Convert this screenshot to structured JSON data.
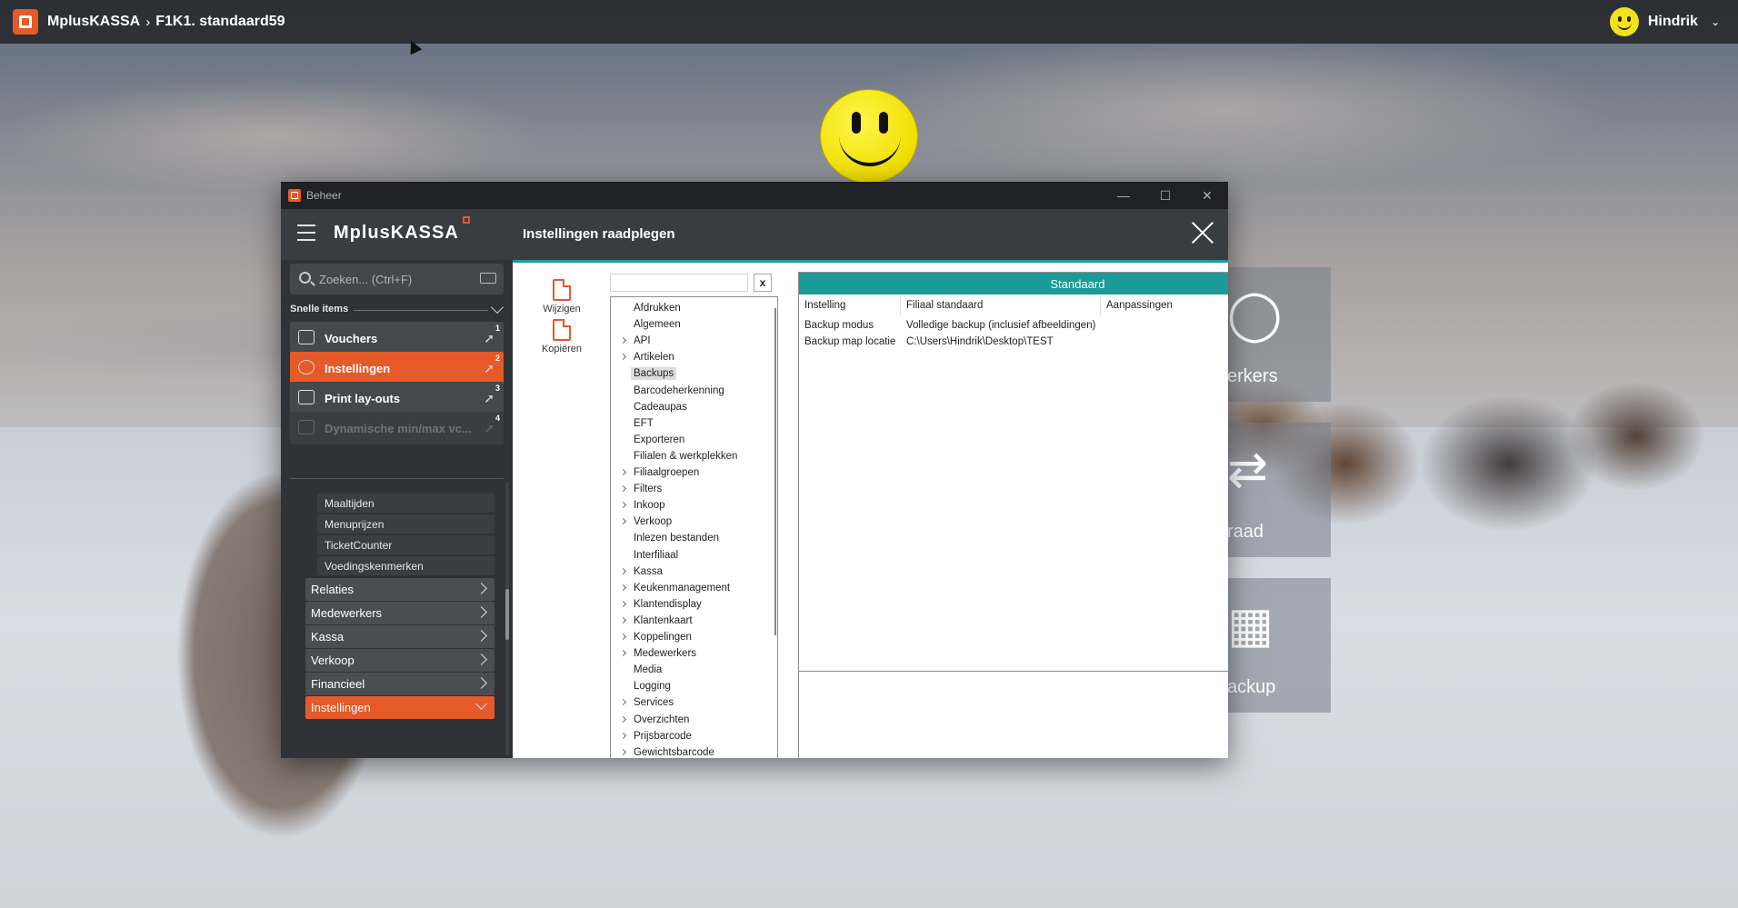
{
  "topbar": {
    "app_name": "MplusKASSA",
    "crumb_sep": "›",
    "location": "F1K1. standaard59",
    "user_name": "Hindrik"
  },
  "background_tiles": [
    {
      "label": "erkers",
      "icon": "person-icon"
    },
    {
      "label": "raad",
      "icon": "transfer-icon"
    },
    {
      "label": "ackup",
      "icon": "grid-icon"
    }
  ],
  "window": {
    "title": "Beheer",
    "minimize": "—",
    "maximize": "☐",
    "close": "✕"
  },
  "header": {
    "brand": "MplusKASSA",
    "title": "Instellingen raadplegen"
  },
  "sidebar": {
    "search_placeholder": "Zoeken... (Ctrl+F)",
    "quick_label": "Snelle items",
    "quick_items": [
      {
        "label": "Vouchers",
        "num": "1",
        "state": "normal"
      },
      {
        "label": "Instellingen",
        "num": "2",
        "state": "active"
      },
      {
        "label": "Print lay-outs",
        "num": "3",
        "state": "normal"
      },
      {
        "label": "Dynamische min/max vc...",
        "num": "4",
        "state": "disabled"
      }
    ],
    "sub_items": [
      "Maaltijden",
      "Menuprijzen",
      "TicketCounter",
      "Voedingskenmerken"
    ],
    "nav_items": [
      {
        "label": "Relaties",
        "active": false
      },
      {
        "label": "Medewerkers",
        "active": false
      },
      {
        "label": "Kassa",
        "active": false
      },
      {
        "label": "Verkoop",
        "active": false
      },
      {
        "label": "Financieel",
        "active": false
      },
      {
        "label": "Instellingen",
        "active": true
      }
    ]
  },
  "actions": {
    "edit_label": "Wijzigen",
    "copy_label": "Kopiëren"
  },
  "filter": {
    "value": "",
    "clear_label": "x"
  },
  "tree": [
    {
      "label": "Afdrukken",
      "expandable": false
    },
    {
      "label": "Algemeen",
      "expandable": false
    },
    {
      "label": "API",
      "expandable": true
    },
    {
      "label": "Artikelen",
      "expandable": true
    },
    {
      "label": "Backups",
      "expandable": false,
      "selected": true
    },
    {
      "label": "Barcodeherkenning",
      "expandable": false
    },
    {
      "label": "Cadeaupas",
      "expandable": false
    },
    {
      "label": "EFT",
      "expandable": false
    },
    {
      "label": "Exporteren",
      "expandable": false
    },
    {
      "label": "Filialen & werkplekken",
      "expandable": false
    },
    {
      "label": "Filiaalgroepen",
      "expandable": true
    },
    {
      "label": "Filters",
      "expandable": true
    },
    {
      "label": "Inkoop",
      "expandable": true
    },
    {
      "label": "Verkoop",
      "expandable": true
    },
    {
      "label": "Inlezen bestanden",
      "expandable": false
    },
    {
      "label": "Interfiliaal",
      "expandable": false
    },
    {
      "label": "Kassa",
      "expandable": true
    },
    {
      "label": "Keukenmanagement",
      "expandable": true
    },
    {
      "label": "Klantendisplay",
      "expandable": true
    },
    {
      "label": "Klantenkaart",
      "expandable": true
    },
    {
      "label": "Koppelingen",
      "expandable": true
    },
    {
      "label": "Medewerkers",
      "expandable": true
    },
    {
      "label": "Media",
      "expandable": false
    },
    {
      "label": "Logging",
      "expandable": false
    },
    {
      "label": "Services",
      "expandable": true
    },
    {
      "label": "Overzichten",
      "expandable": true
    },
    {
      "label": "Prijsbarcode",
      "expandable": true
    },
    {
      "label": "Gewichtsbarcode",
      "expandable": true
    }
  ],
  "grid": {
    "group_header": "Standaard",
    "columns": [
      "Instelling",
      "Filiaal standaard",
      "Aanpassingen"
    ],
    "rows": [
      [
        "Backup modus",
        "Volledige backup (inclusief afbeeldingen)",
        ""
      ],
      [
        "Backup map locatie",
        "C:\\Users\\Hindrik\\Desktop\\TEST",
        ""
      ]
    ]
  },
  "colors": {
    "accent": "#e55a28",
    "teal": "#1a9b98",
    "dark": "#2f3236"
  }
}
